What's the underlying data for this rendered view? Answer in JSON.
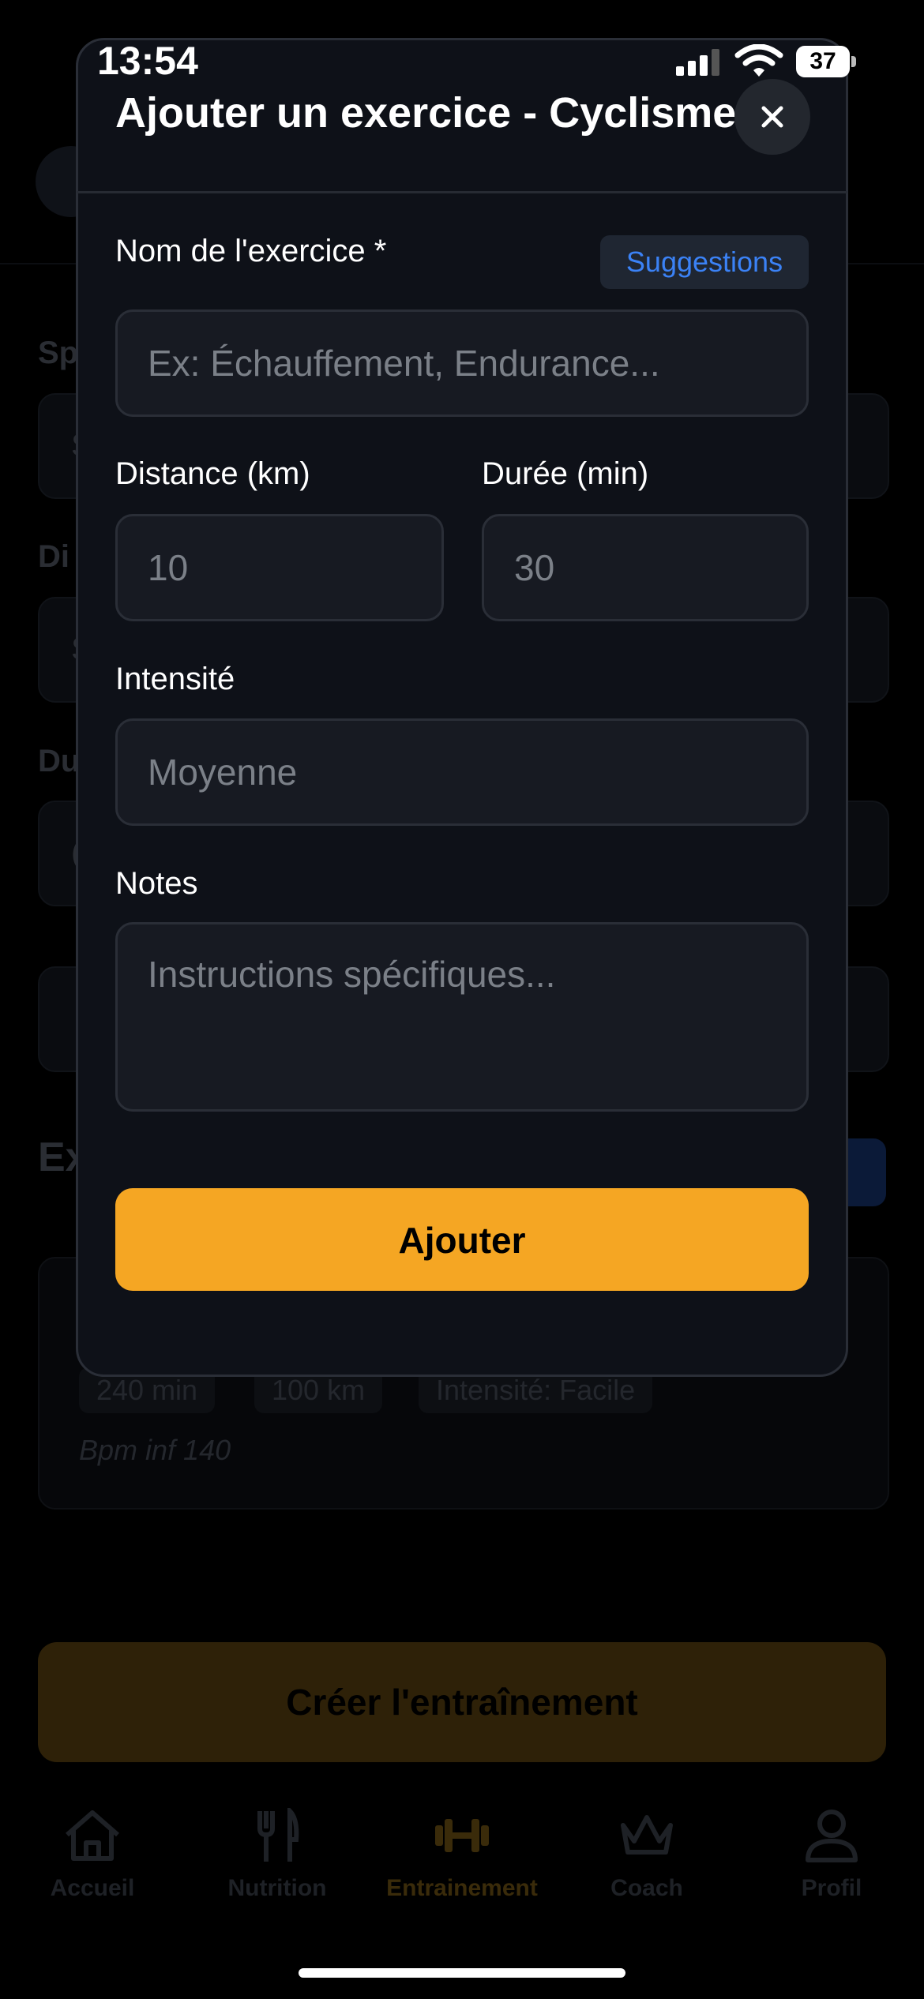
{
  "status_bar": {
    "time": "13:54",
    "battery": "37"
  },
  "background": {
    "labels": [
      "Sp",
      "Di",
      "Du"
    ],
    "field_letters": [
      "S",
      "S",
      "("
    ],
    "exercises_title": "Ex",
    "exercise_card": {
      "chips": [
        "240 min",
        "100 km",
        "Intensité: Facile"
      ],
      "note": "Bpm inf 140"
    },
    "create_button": "Créer l'entraînement",
    "tabs": [
      {
        "label": "Accueil",
        "icon": "home-icon"
      },
      {
        "label": "Nutrition",
        "icon": "fork-knife-icon"
      },
      {
        "label": "Entrainement",
        "icon": "dumbbell-icon",
        "active": true
      },
      {
        "label": "Coach",
        "icon": "crown-icon"
      },
      {
        "label": "Profil",
        "icon": "user-icon"
      }
    ]
  },
  "modal": {
    "title": "Ajouter un exercice - Cyclisme",
    "name_label": "Nom de l'exercice *",
    "suggestions_label": "Suggestions",
    "name_placeholder": "Ex: Échauffement, Endurance...",
    "distance_label": "Distance (km)",
    "distance_placeholder": "10",
    "duration_label": "Durée (min)",
    "duration_placeholder": "30",
    "intensity_label": "Intensité",
    "intensity_placeholder": "Moyenne",
    "notes_label": "Notes",
    "notes_placeholder": "Instructions spécifiques...",
    "submit_label": "Ajouter"
  },
  "colors": {
    "accent": "#f5a623",
    "link": "#3b82f6",
    "modal_bg": "#0e1118",
    "input_bg": "#171a22"
  }
}
